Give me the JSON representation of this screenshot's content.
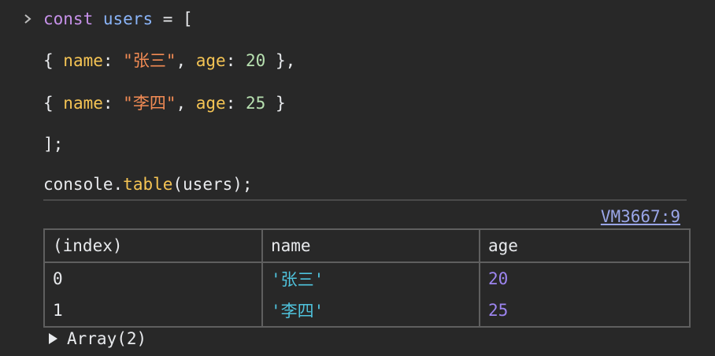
{
  "input": {
    "line1": {
      "keyword": "const",
      "var": "users",
      "op": " = ["
    },
    "line2": {
      "open": "{ ",
      "key1": "name",
      "colon1": ": ",
      "val1": "\"张三\"",
      "comma1": ", ",
      "key2": "age",
      "colon2": ": ",
      "val2": "20",
      "close": " },"
    },
    "line3": {
      "open": "{ ",
      "key1": "name",
      "colon1": ": ",
      "val1": "\"李四\"",
      "comma1": ", ",
      "key2": "age",
      "colon2": ": ",
      "val2": "25",
      "close": " }"
    },
    "line4": "];",
    "line5": {
      "obj": "console",
      "dot": ".",
      "method": "table",
      "args": "(users);"
    }
  },
  "output": {
    "source_link": "VM3667:9",
    "table": {
      "headers": [
        "(index)",
        "name",
        "age"
      ],
      "rows": [
        {
          "index": "0",
          "name": "'张三'",
          "age": "20"
        },
        {
          "index": "1",
          "name": "'李四'",
          "age": "25"
        }
      ]
    },
    "array_summary": "Array(2)"
  },
  "colors": {
    "background": "#282828",
    "keyword": "#c792ea",
    "variable": "#8ab4f8",
    "property": "#f5c454",
    "string": "#f28b54",
    "number": "#b7e0b0",
    "table_string": "#4fc3dd",
    "table_number": "#9d85f0",
    "link": "#9aa6e8"
  },
  "icons": {
    "prompt": "chevron-right-icon",
    "expand": "triangle-right-icon"
  }
}
